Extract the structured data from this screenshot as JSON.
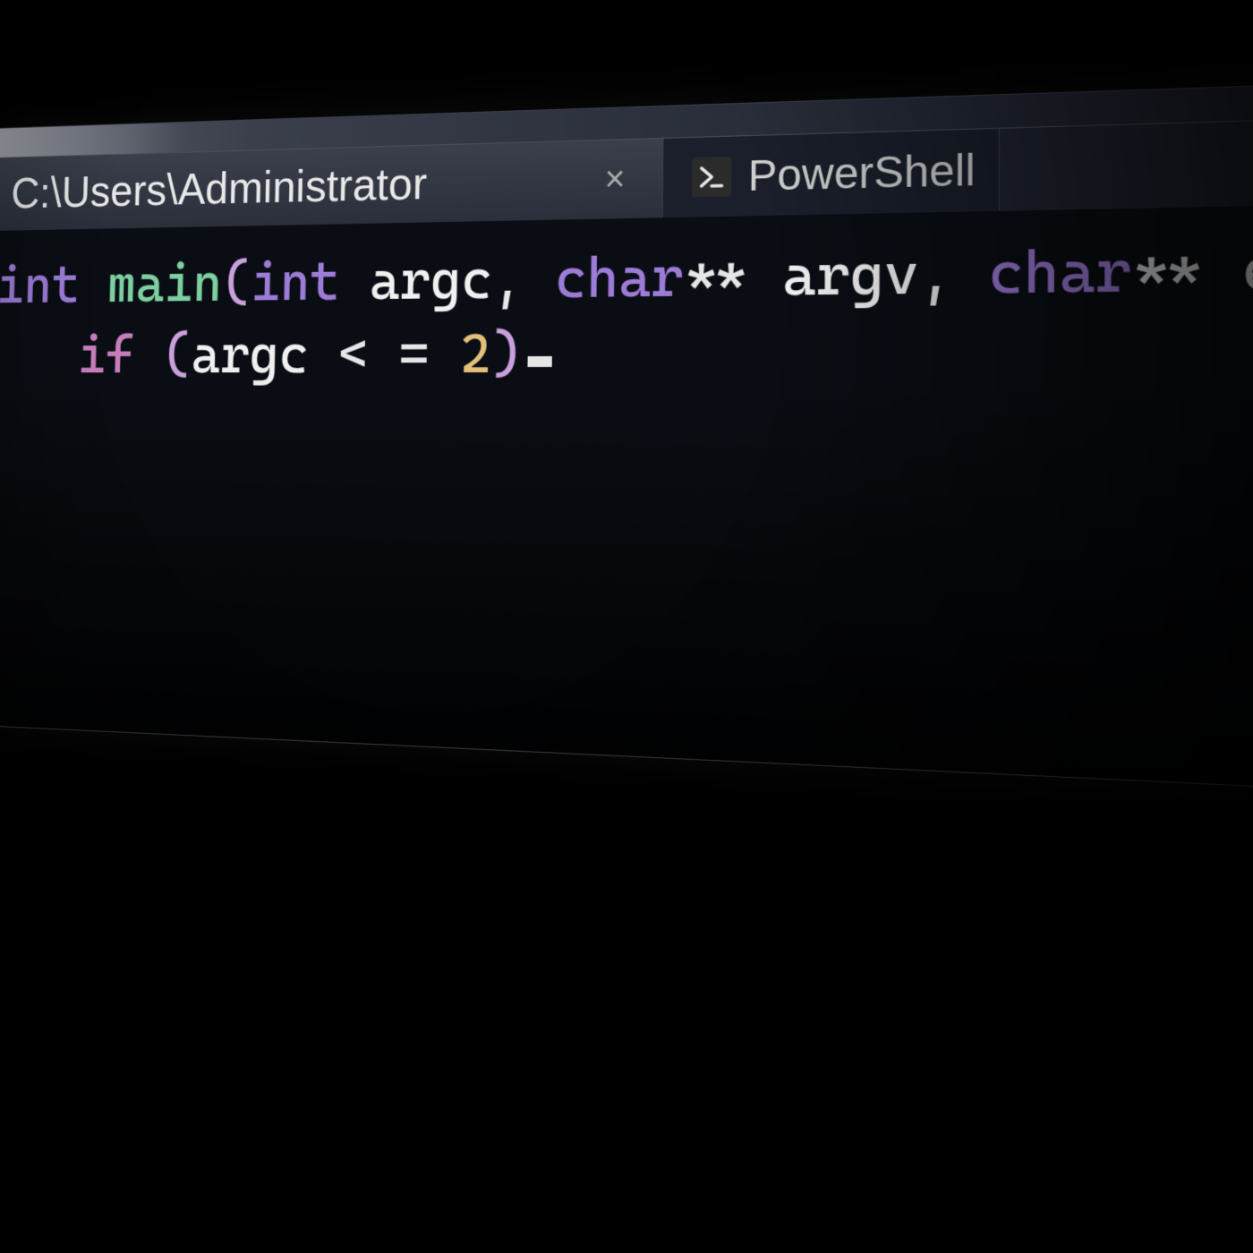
{
  "tabs": [
    {
      "title": "C:\\Users\\Administrator",
      "active": true
    },
    {
      "title": "PowerShell",
      "active": false
    }
  ],
  "close_glyph": "×",
  "code": {
    "line1": {
      "t1": "int",
      "fn": "main",
      "t2": "int",
      "a1": "argc",
      "t3": "char",
      "ptr": "**",
      "a2": "argv",
      "t4": "char",
      "a3": "e"
    },
    "line2": {
      "kw": "if",
      "a": "argc",
      "op": "< =",
      "n": "2"
    }
  }
}
